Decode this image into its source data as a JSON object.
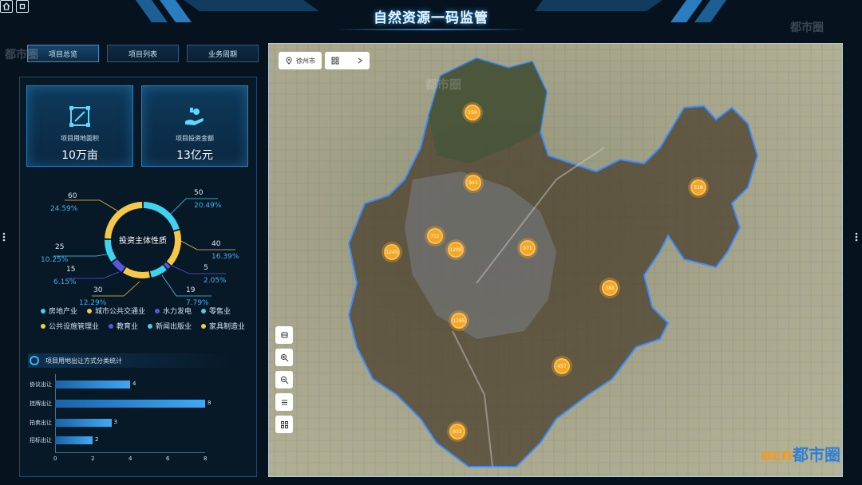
{
  "header": {
    "title": "自然资源一码监管"
  },
  "tabs": [
    {
      "label": "项目总览",
      "active": true
    },
    {
      "label": "项目列表",
      "active": false
    },
    {
      "label": "业务周期",
      "active": false
    }
  ],
  "cards": [
    {
      "label": "项目用地面积",
      "value": "10万亩",
      "icon": "area-icon"
    },
    {
      "label": "项目投资金额",
      "value": "13亿元",
      "icon": "investment-icon"
    }
  ],
  "donut": {
    "center": "投资主体性质",
    "slices": [
      {
        "value": "50",
        "pct": "20.49%"
      },
      {
        "value": "40",
        "pct": "16.39%"
      },
      {
        "value": "5",
        "pct": "2.05%"
      },
      {
        "value": "19",
        "pct": "7.79%"
      },
      {
        "value": "30",
        "pct": "12.29%"
      },
      {
        "value": "15",
        "pct": "6.15%"
      },
      {
        "value": "25",
        "pct": "10.25%"
      },
      {
        "value": "60",
        "pct": "24.59%"
      }
    ],
    "legend": [
      {
        "name": "房地产业",
        "color": "#3fd3ee"
      },
      {
        "name": "城市公共交通业",
        "color": "#f5c84a"
      },
      {
        "name": "水力发电",
        "color": "#5b55e0"
      },
      {
        "name": "零售业",
        "color": "#3fd3ee"
      },
      {
        "name": "公共设施管理业",
        "color": "#f5c84a"
      },
      {
        "name": "教育业",
        "color": "#5b55e0"
      },
      {
        "name": "新闻出版业",
        "color": "#3fd3ee"
      },
      {
        "name": "家具制造业",
        "color": "#f5c84a"
      }
    ]
  },
  "bar_section": {
    "title": "项目用地出让方式分类统计"
  },
  "chart_data": {
    "type": "bar",
    "orientation": "horizontal",
    "categories": [
      "协议出让",
      "挂牌出让",
      "拍卖出让",
      "招标出让"
    ],
    "values": [
      4,
      8,
      3,
      2
    ],
    "xlim": [
      0,
      8
    ],
    "xticks": [
      "0",
      "2",
      "4",
      "6",
      "8"
    ]
  },
  "map": {
    "location": "徐州市",
    "clusters": [
      {
        "label": "259"
      },
      {
        "label": "943"
      },
      {
        "label": "518"
      },
      {
        "label": "712"
      },
      {
        "label": "1200"
      },
      {
        "label": "971"
      },
      {
        "label": "1245"
      },
      {
        "label": "388"
      },
      {
        "label": "1265"
      },
      {
        "label": "457"
      },
      {
        "label": "832"
      }
    ]
  },
  "branding": {
    "watermark": "都市圈",
    "brand_a": "ocn",
    "brand_b": "都市圈"
  }
}
